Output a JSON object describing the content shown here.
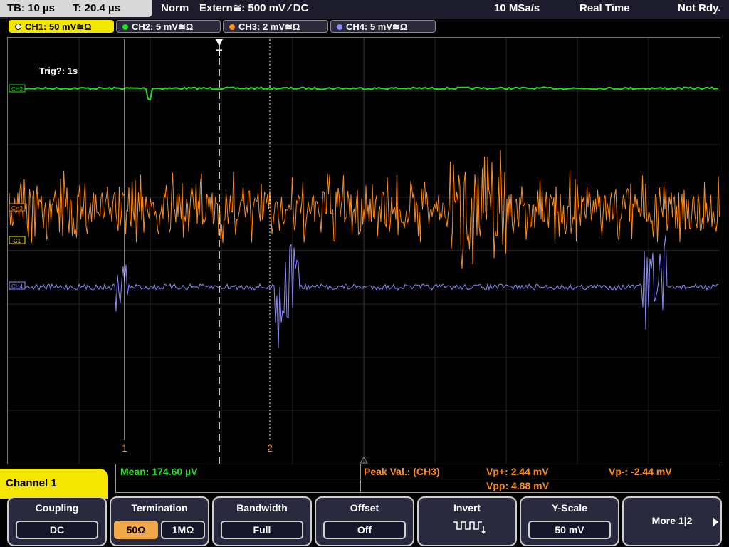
{
  "status": {
    "timebase": "TB: 10 µs",
    "trigger_time": "T: 20.4 µs",
    "mode": "Norm",
    "trigger_source": "Extern≅: 500 mV ⁄ DC",
    "sample_rate": "10 MSa/s",
    "acq_mode": "Real Time",
    "state": "Not Rdy."
  },
  "channels": [
    {
      "label": "CH1: 50 mV≅Ω",
      "color": "#f5e600"
    },
    {
      "label": "CH2: 5 mV≅Ω",
      "color": "#22dd22"
    },
    {
      "label": "CH3: 2 mV≅Ω",
      "color": "#ff8c1a"
    },
    {
      "label": "CH4: 5 mV≅Ω",
      "color": "#8c8cff"
    }
  ],
  "screen": {
    "trigger_info": "Trig?: 1s",
    "trigger_marker": "T",
    "ch_markers": {
      "ch2": "CH2",
      "ch3": "CH3",
      "ch1": "C1",
      "ch4": "CH4"
    },
    "cursor1_label": "1",
    "cursor2_label": "2"
  },
  "measurements": {
    "mean": "Mean: 174.60 µV",
    "peak_label": "Peak Val.: (CH3)",
    "vp_plus": "Vp+: 2.44 mV",
    "vp_minus": "Vp-: -2.44 mV",
    "vpp": "Vpp: 4.88 mV"
  },
  "menu": {
    "channel_title": "Channel 1",
    "coupling": {
      "title": "Coupling",
      "value": "DC"
    },
    "termination": {
      "title": "Termination",
      "opt1": "50Ω",
      "opt2": "1MΩ"
    },
    "bandwidth": {
      "title": "Bandwidth",
      "value": "Full"
    },
    "offset": {
      "title": "Offset",
      "value": "Off"
    },
    "invert": {
      "title": "Invert"
    },
    "yscale": {
      "title": "Y-Scale",
      "value": "50 mV"
    },
    "more": {
      "title": "More 1|2"
    }
  }
}
